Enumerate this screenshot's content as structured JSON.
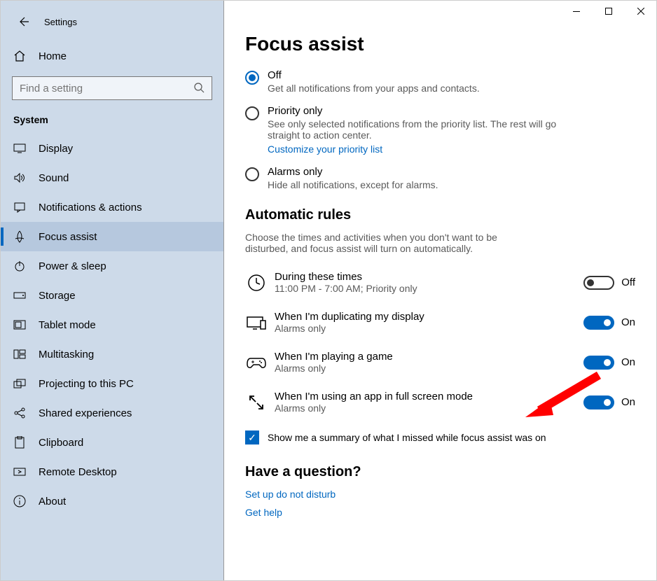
{
  "window": {
    "title": "Settings"
  },
  "sidebar": {
    "home_label": "Home",
    "search_placeholder": "Find a setting",
    "section_label": "System",
    "items": [
      {
        "label": "Display"
      },
      {
        "label": "Sound"
      },
      {
        "label": "Notifications & actions"
      },
      {
        "label": "Focus assist"
      },
      {
        "label": "Power & sleep"
      },
      {
        "label": "Storage"
      },
      {
        "label": "Tablet mode"
      },
      {
        "label": "Multitasking"
      },
      {
        "label": "Projecting to this PC"
      },
      {
        "label": "Shared experiences"
      },
      {
        "label": "Clipboard"
      },
      {
        "label": "Remote Desktop"
      },
      {
        "label": "About"
      }
    ]
  },
  "main": {
    "page_title": "Focus assist",
    "radios": {
      "off": {
        "label": "Off",
        "desc": "Get all notifications from your apps and contacts."
      },
      "priority": {
        "label": "Priority only",
        "desc": "See only selected notifications from the priority list. The rest will go straight to action center.",
        "link": "Customize your priority list"
      },
      "alarms": {
        "label": "Alarms only",
        "desc": "Hide all notifications, except for alarms."
      }
    },
    "auto_rules": {
      "heading": "Automatic rules",
      "desc": "Choose the times and activities when you don't want to be disturbed, and focus assist will turn on automatically.",
      "items": [
        {
          "label": "During these times",
          "sub": "11:00 PM - 7:00 AM; Priority only",
          "state": "Off",
          "on": false
        },
        {
          "label": "When I'm duplicating my display",
          "sub": "Alarms only",
          "state": "On",
          "on": true
        },
        {
          "label": "When I'm playing a game",
          "sub": "Alarms only",
          "state": "On",
          "on": true
        },
        {
          "label": "When I'm using an app in full screen mode",
          "sub": "Alarms only",
          "state": "On",
          "on": true
        }
      ]
    },
    "summary_checkbox": "Show me a summary of what I missed while focus assist was on",
    "question": {
      "heading": "Have a question?",
      "link1": "Set up do not disturb",
      "link2": "Get help"
    }
  }
}
